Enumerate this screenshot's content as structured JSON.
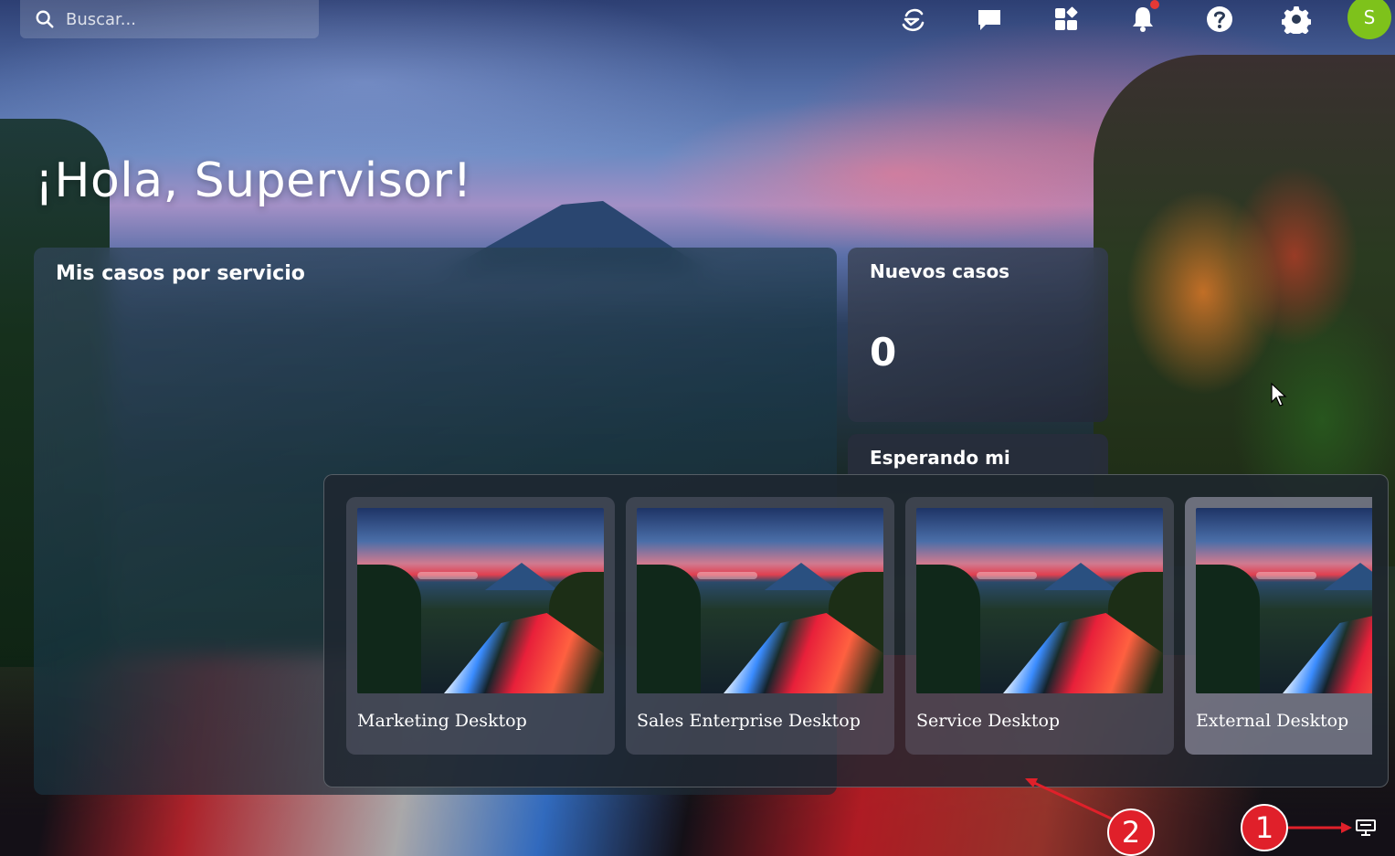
{
  "search": {
    "placeholder": "Buscar..."
  },
  "topbar": {
    "icons": [
      "ai-assistant-icon",
      "chat-icon",
      "apps-icon",
      "notifications-icon",
      "help-icon",
      "settings-icon"
    ],
    "avatar_initial": "S",
    "avatar_color": "#7ec21b",
    "notification_dot_color": "#e53935"
  },
  "greeting": "¡Hola, Supervisor!",
  "widgets": {
    "cases_by_service": {
      "title": "Mis casos por servicio"
    },
    "new_cases": {
      "title": "Nuevos casos",
      "count": "0"
    },
    "waiting": {
      "title": "Esperando mi"
    }
  },
  "desktop_switcher": {
    "desktops": [
      {
        "label": "Marketing Desktop"
      },
      {
        "label": "Sales Enterprise Desktop"
      },
      {
        "label": "Service Desktop"
      },
      {
        "label": "External Desktop"
      }
    ]
  },
  "annotations": {
    "badge_1": "1",
    "badge_2": "2",
    "badge_color": "#e0202a"
  }
}
